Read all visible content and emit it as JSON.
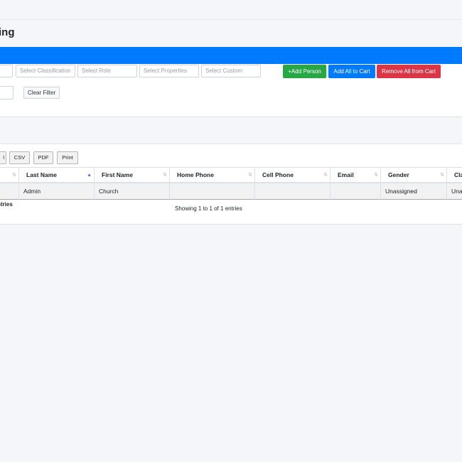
{
  "page": {
    "title": "ing"
  },
  "filters": {
    "selects": [
      {
        "placeholder": ""
      },
      {
        "placeholder": "Select Classification"
      },
      {
        "placeholder": "Select Role"
      },
      {
        "placeholder": "Select Properties"
      },
      {
        "placeholder": "Select Custom"
      }
    ],
    "add_person": "+Add Person",
    "add_all_to_cart": "Add All to Cart",
    "remove_all_from_cart": "Remove All from Cart",
    "clear_filter": "Clear Filter"
  },
  "export_buttons": [
    "l",
    "CSV",
    "PDF",
    "Print"
  ],
  "table": {
    "columns": [
      "",
      "Last Name",
      "First Name",
      "Home Phone",
      "Cell Phone",
      "Email",
      "Gender",
      "Cla"
    ],
    "rows": [
      [
        "",
        "Admin",
        "Church",
        "",
        "",
        "",
        "Unassigned",
        "Una"
      ]
    ]
  },
  "info": {
    "left": "ntries",
    "center": "Showing 1 to 1 of 1 entries"
  },
  "colors": {
    "primary": "#007bff",
    "success": "#28a745",
    "danger": "#dc3545",
    "background": "#f4f6f9"
  }
}
